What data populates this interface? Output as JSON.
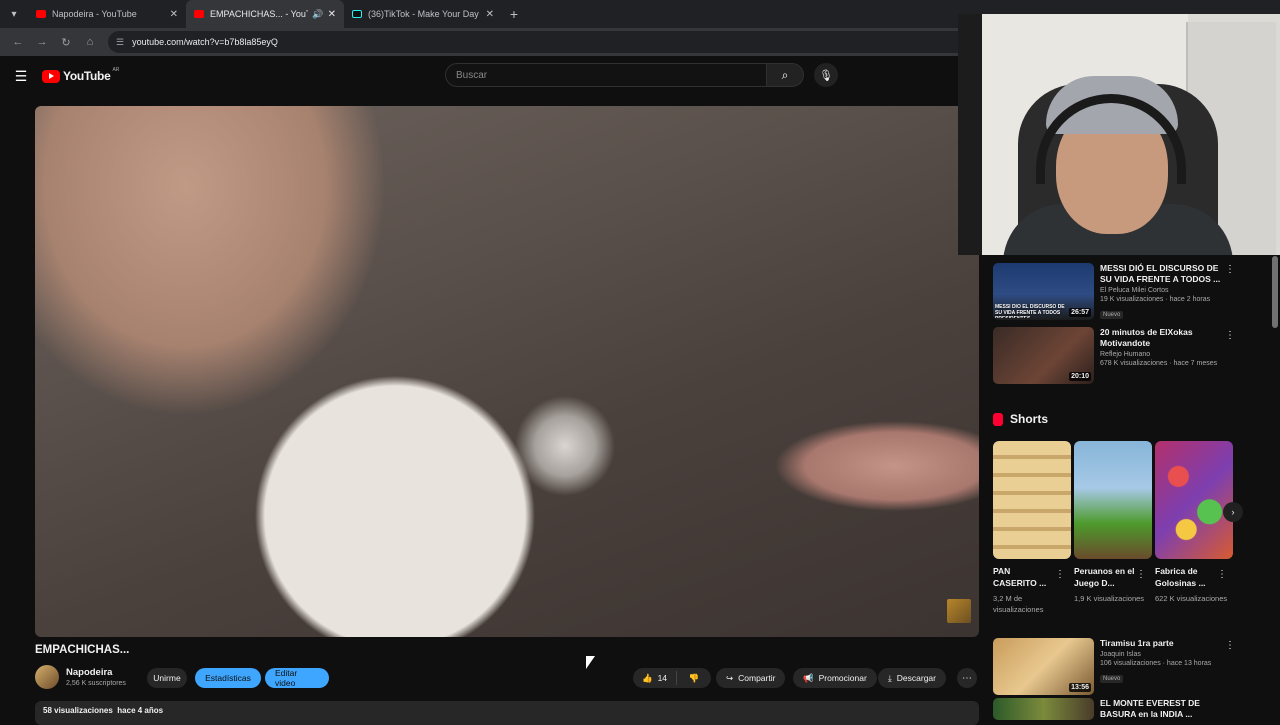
{
  "browser": {
    "tabs": [
      {
        "title": "Napodeira - YouTube",
        "favicon": "youtube-icon",
        "active": false
      },
      {
        "title": "EMPACHICHAS... - YouTube",
        "favicon": "youtube-icon",
        "active": true
      },
      {
        "title": "(36)TikTok - Make Your Day",
        "favicon": "tiktok-icon",
        "active": false
      }
    ],
    "url": "youtube.com/watch?v=b7b8la85eyQ"
  },
  "youtube": {
    "logo_text": "YouTube",
    "country": "AR",
    "search_placeholder": "Buscar"
  },
  "video": {
    "title": "EMPACHICHAS...",
    "channel": "Napodeira",
    "subscribers": "2,56 K suscriptores",
    "join_label": "Unirme",
    "stats_label": "Estadísticas",
    "edit_label": "Editar video",
    "likes": "14",
    "share_label": "Compartir",
    "promote_label": "Promocionar",
    "download_label": "Descargar",
    "views": "58 visualizaciones",
    "age": "hace 4 años"
  },
  "recommendations": [
    {
      "title": "MESSI DIÓ EL DISCURSO DE SU VIDA FRENTE A TODOS ...",
      "channel": "El Peluca Milei Cortos",
      "meta": "19 K visualizaciones · hace 2 horas",
      "badge": "Nuevo",
      "duration": "26:57",
      "thumb_text": "MESSI DIÓ EL DISCURSO DE SU VIDA FRENTE A TODOS PRESIDENTES"
    },
    {
      "title": "20 minutos de ElXokas Motivandote",
      "channel": "Reflejo Humano",
      "meta": "678 K visualizaciones · hace 7 meses",
      "badge": "",
      "duration": "20:10"
    }
  ],
  "shorts": {
    "heading": "Shorts",
    "items": [
      {
        "title": "PAN CASERITO ...",
        "views": "3,2 M de visualizaciones"
      },
      {
        "title": "Peruanos en el Juego D...",
        "views": "1,9 K visualizaciones"
      },
      {
        "title": "Fabrica de Golosinas ...",
        "views": "622 K visualizaciones"
      }
    ]
  },
  "recommendations_2": [
    {
      "title": "Tiramisu 1ra parte",
      "channel": "Joaquin Islas",
      "meta": "106 visualizaciones · hace 13 horas",
      "badge": "Nuevo",
      "duration": "13:56"
    },
    {
      "title": "EL MONTE EVEREST DE BASURA en la INDIA ..."
    }
  ]
}
